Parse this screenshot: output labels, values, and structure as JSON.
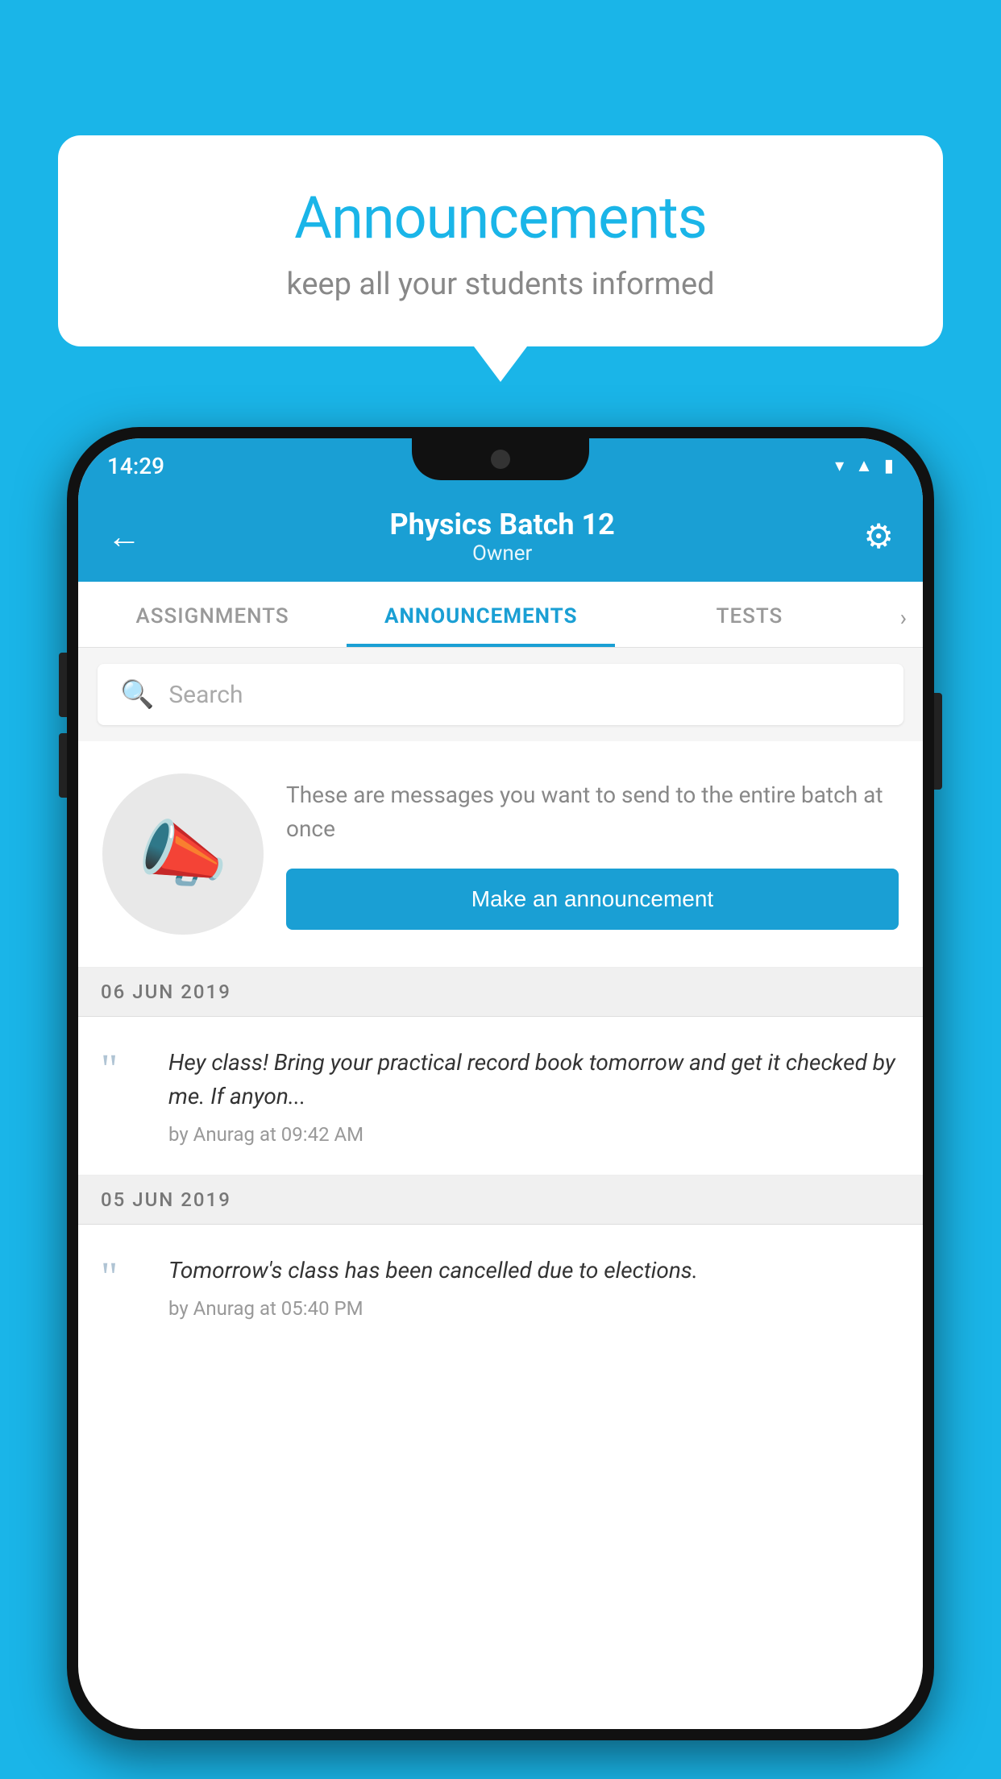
{
  "bubble": {
    "title": "Announcements",
    "subtitle": "keep all your students informed"
  },
  "phone": {
    "statusBar": {
      "time": "14:29"
    },
    "header": {
      "title": "Physics Batch 12",
      "subtitle": "Owner",
      "backLabel": "←",
      "gearLabel": "⚙"
    },
    "tabs": [
      {
        "label": "ASSIGNMENTS",
        "active": false
      },
      {
        "label": "ANNOUNCEMENTS",
        "active": true
      },
      {
        "label": "TESTS",
        "active": false
      }
    ],
    "search": {
      "placeholder": "Search"
    },
    "promo": {
      "description": "These are messages you want to send to the entire batch at once",
      "buttonLabel": "Make an announcement"
    },
    "dates": [
      {
        "label": "06  JUN  2019",
        "announcements": [
          {
            "text": "Hey class! Bring your practical record book tomorrow and get it checked by me. If anyon...",
            "meta": "by Anurag at 09:42 AM"
          }
        ]
      },
      {
        "label": "05  JUN  2019",
        "announcements": [
          {
            "text": "Tomorrow's class has been cancelled due to elections.",
            "meta": "by Anurag at 05:40 PM"
          }
        ]
      }
    ]
  }
}
